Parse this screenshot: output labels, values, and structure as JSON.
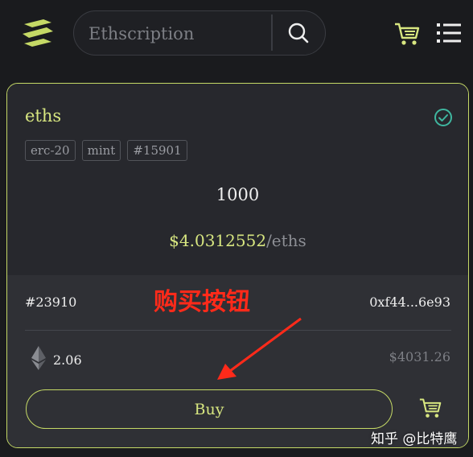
{
  "header": {
    "search_placeholder": "Ethscription",
    "icons": {
      "logo": "logo-icon",
      "search": "search-icon",
      "cart": "cart-icon",
      "menu": "menu-icon"
    }
  },
  "card": {
    "ticker": "eths",
    "tags": [
      "erc-20",
      "mint",
      "#15901"
    ],
    "amount": "1000",
    "price_value": "$4.0312552",
    "price_unit": "/eths",
    "inscription_id": "#23910",
    "owner_address": "0xf44...6e93",
    "eth_price": "2.06",
    "usd_price": "$4031.26",
    "buy_label": "Buy"
  },
  "annotation": {
    "text": "购买按钮"
  },
  "watermark": {
    "text": "知乎 @比特鹰"
  },
  "colors": {
    "accent": "#d7e680",
    "border_accent": "#c5d966",
    "check": "#3fb7a0",
    "annotation": "#ff2a1a",
    "background": "#1a1b1e",
    "card": "#27282d"
  }
}
